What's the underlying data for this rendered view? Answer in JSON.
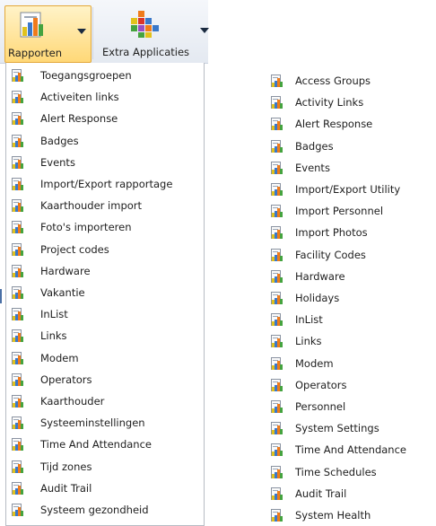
{
  "ribbon": {
    "reports_button": {
      "label": "Rapporten",
      "icon": "reports-icon"
    },
    "extra_apps_button": {
      "label": "Extra Applicaties",
      "icon": "extra-applications-icon"
    }
  },
  "menu_dutch": {
    "items": [
      {
        "label": "Toegangsgroepen",
        "icon": "report-icon"
      },
      {
        "label": "Activeiten links",
        "icon": "report-icon"
      },
      {
        "label": "Alert Response",
        "icon": "report-icon"
      },
      {
        "label": "Badges",
        "icon": "report-icon"
      },
      {
        "label": "Events",
        "icon": "report-icon"
      },
      {
        "label": "Import/Export rapportage",
        "icon": "report-icon"
      },
      {
        "label": "Kaarthouder import",
        "icon": "report-icon"
      },
      {
        "label": "Foto's importeren",
        "icon": "report-icon"
      },
      {
        "label": "Project codes",
        "icon": "report-icon"
      },
      {
        "label": "Hardware",
        "icon": "report-icon"
      },
      {
        "label": "Vakantie",
        "icon": "report-icon"
      },
      {
        "label": "InList",
        "icon": "report-icon"
      },
      {
        "label": "Links",
        "icon": "report-icon"
      },
      {
        "label": "Modem",
        "icon": "report-icon"
      },
      {
        "label": "Operators",
        "icon": "report-icon"
      },
      {
        "label": "Kaarthouder",
        "icon": "report-icon"
      },
      {
        "label": "Systeeminstellingen",
        "icon": "report-icon"
      },
      {
        "label": "Time And Attendance",
        "icon": "report-icon"
      },
      {
        "label": "Tijd zones",
        "icon": "report-icon"
      },
      {
        "label": "Audit Trail",
        "icon": "report-icon"
      },
      {
        "label": "Systeem gezondheid",
        "icon": "report-icon"
      }
    ]
  },
  "menu_english": {
    "items": [
      {
        "label": "Access Groups",
        "icon": "report-icon"
      },
      {
        "label": "Activity Links",
        "icon": "report-icon"
      },
      {
        "label": "Alert Response",
        "icon": "report-icon"
      },
      {
        "label": "Badges",
        "icon": "report-icon"
      },
      {
        "label": "Events",
        "icon": "report-icon"
      },
      {
        "label": "Import/Export Utility",
        "icon": "report-icon"
      },
      {
        "label": "Import Personnel",
        "icon": "report-icon"
      },
      {
        "label": "Import Photos",
        "icon": "report-icon"
      },
      {
        "label": "Facility Codes",
        "icon": "report-icon"
      },
      {
        "label": "Hardware",
        "icon": "report-icon"
      },
      {
        "label": "Holidays",
        "icon": "report-icon"
      },
      {
        "label": "InList",
        "icon": "report-icon"
      },
      {
        "label": "Links",
        "icon": "report-icon"
      },
      {
        "label": "Modem",
        "icon": "report-icon"
      },
      {
        "label": "Operators",
        "icon": "report-icon"
      },
      {
        "label": "Personnel",
        "icon": "report-icon"
      },
      {
        "label": "System Settings",
        "icon": "report-icon"
      },
      {
        "label": "Time And Attendance",
        "icon": "report-icon"
      },
      {
        "label": "Time Schedules",
        "icon": "report-icon"
      },
      {
        "label": "Audit Trail",
        "icon": "report-icon"
      },
      {
        "label": "System Health",
        "icon": "report-icon"
      }
    ]
  },
  "colors": {
    "active_button_top": "#fff3c8",
    "active_button_bottom": "#ffd877",
    "active_button_border": "#e3a83a",
    "menu_border": "#b7bcc4"
  }
}
